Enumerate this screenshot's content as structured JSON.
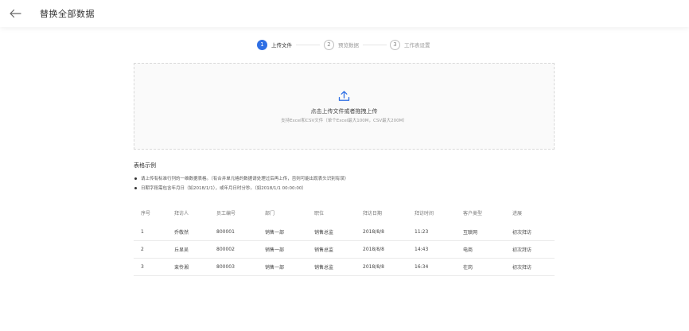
{
  "header": {
    "title": "替换全部数据"
  },
  "steps": [
    {
      "number": "1",
      "label": "上传文件",
      "active": true
    },
    {
      "number": "2",
      "label": "预览数据",
      "active": false
    },
    {
      "number": "3",
      "label": "工作表设置",
      "active": false
    }
  ],
  "upload": {
    "title": "点击上传文件或者拖拽上传",
    "subtitle": "支持Excel和CSV文件（单个Excel最大100M，CSV最大200M）"
  },
  "example": {
    "title": "表格示例",
    "notes": [
      "请上传有标准行列的一维数据表格。（有合并单元格的数据请处理过后再上传，否则可能出现表头识别有误）",
      "日期字段需包含年月日（如2018/1/1），或年月日时分秒。（如2018/1/1 00:00:00）"
    ]
  },
  "table": {
    "columns": [
      "序号",
      "拜访人",
      "员工编号",
      "部门",
      "职位",
      "拜访日期",
      "拜访时间",
      "客户类型",
      "进展"
    ],
    "rows": [
      [
        "1",
        "乔敬然",
        "800001",
        "销售一部",
        "销售总监",
        "2018/8/8",
        "11:23",
        "互联网",
        "初次拜访"
      ],
      [
        "2",
        "丘显吴",
        "800002",
        "销售一部",
        "销售总监",
        "2018/8/8",
        "14:43",
        "电商",
        "初次拜访"
      ],
      [
        "3",
        "束怜湘",
        "800003",
        "销售一部",
        "销售总监",
        "2018/8/8",
        "16:34",
        "在岗",
        "初次拜访"
      ]
    ]
  }
}
